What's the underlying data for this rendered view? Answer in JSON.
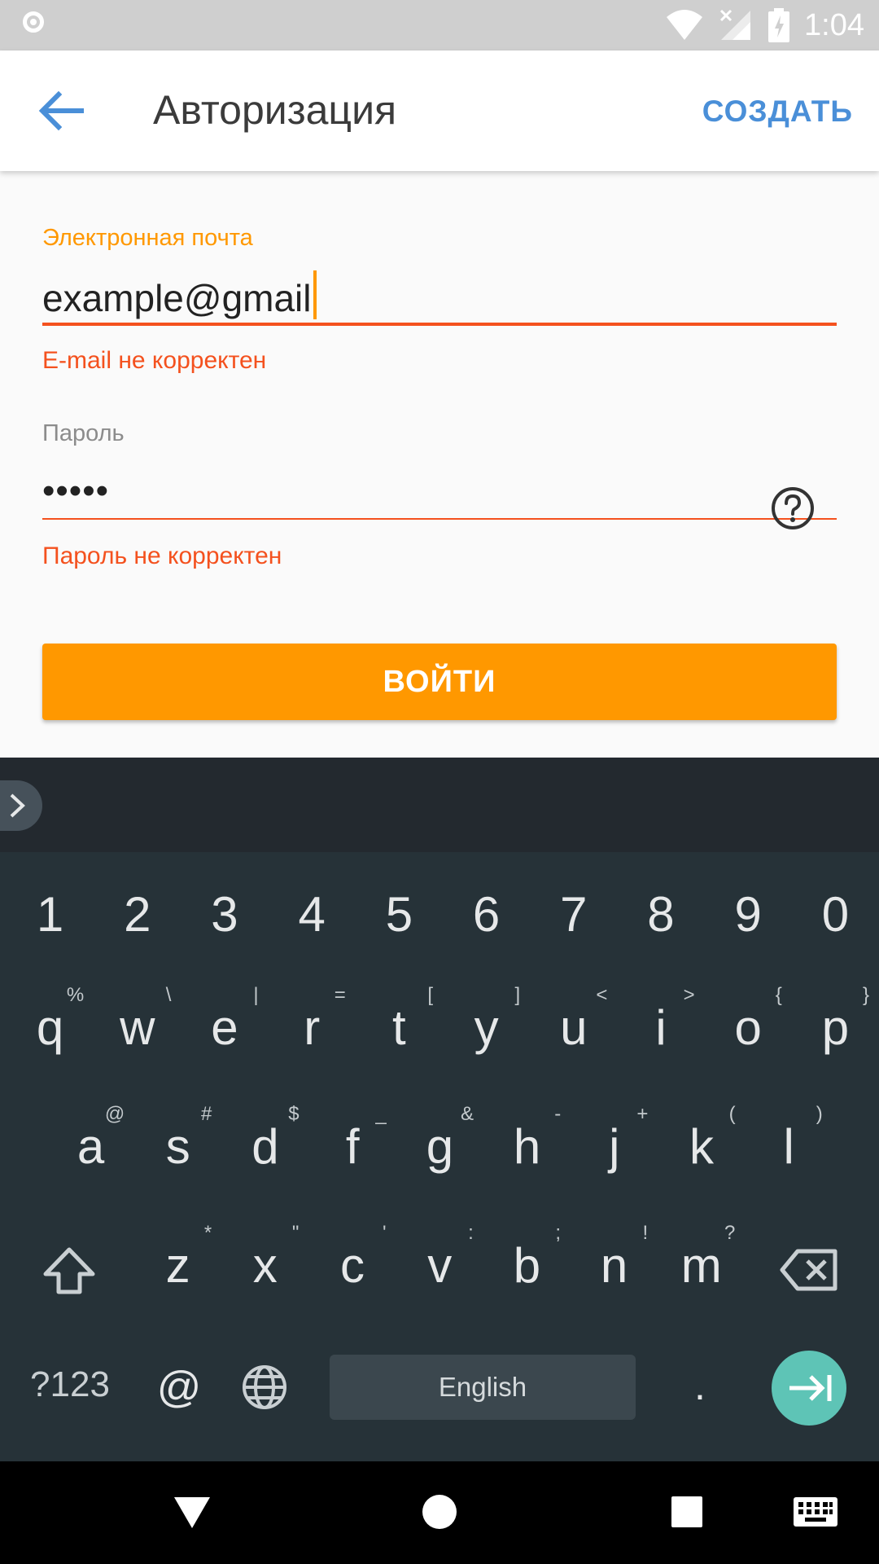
{
  "status_bar": {
    "time": "1:04"
  },
  "app_bar": {
    "title": "Авторизация",
    "create_label": "СОЗДАТЬ"
  },
  "form": {
    "email_label": "Электронная почта",
    "email_value": "example@gmail",
    "email_error": "E-mail не корректен",
    "password_label": "Пароль",
    "password_value": "•••••",
    "password_error": "Пароль не корректен",
    "login_label": "ВОЙТИ"
  },
  "keyboard": {
    "number_row": [
      "1",
      "2",
      "3",
      "4",
      "5",
      "6",
      "7",
      "8",
      "9",
      "0"
    ],
    "row1": [
      {
        "k": "q",
        "h": "%"
      },
      {
        "k": "w",
        "h": "\\"
      },
      {
        "k": "e",
        "h": "|"
      },
      {
        "k": "r",
        "h": "="
      },
      {
        "k": "t",
        "h": "["
      },
      {
        "k": "y",
        "h": "]"
      },
      {
        "k": "u",
        "h": "<"
      },
      {
        "k": "i",
        "h": ">"
      },
      {
        "k": "o",
        "h": "{"
      },
      {
        "k": "p",
        "h": "}"
      }
    ],
    "row2": [
      {
        "k": "a",
        "h": "@"
      },
      {
        "k": "s",
        "h": "#"
      },
      {
        "k": "d",
        "h": "$"
      },
      {
        "k": "f",
        "h": "_"
      },
      {
        "k": "g",
        "h": "&"
      },
      {
        "k": "h",
        "h": "-"
      },
      {
        "k": "j",
        "h": "+"
      },
      {
        "k": "k",
        "h": "("
      },
      {
        "k": "l",
        "h": ")"
      }
    ],
    "row3": [
      {
        "k": "z",
        "h": "*"
      },
      {
        "k": "x",
        "h": "\""
      },
      {
        "k": "c",
        "h": "'"
      },
      {
        "k": "v",
        "h": ":"
      },
      {
        "k": "b",
        "h": ";"
      },
      {
        "k": "n",
        "h": "!"
      },
      {
        "k": "m",
        "h": "?"
      }
    ],
    "symbols_label": "?123",
    "at_label": "@",
    "space_label": "English",
    "period_label": "."
  },
  "colors": {
    "accent": "#ff9800",
    "error": "#f4511e",
    "link": "#4a8fd8",
    "enter": "#5ec4b6"
  },
  "icons": [
    "back-arrow-icon",
    "help-icon",
    "wifi-icon",
    "signal-icon",
    "battery-icon",
    "shift-icon",
    "backspace-icon",
    "globe-icon",
    "enter-icon",
    "nav-back-icon",
    "nav-home-icon",
    "nav-recents-icon",
    "keyboard-icon"
  ]
}
